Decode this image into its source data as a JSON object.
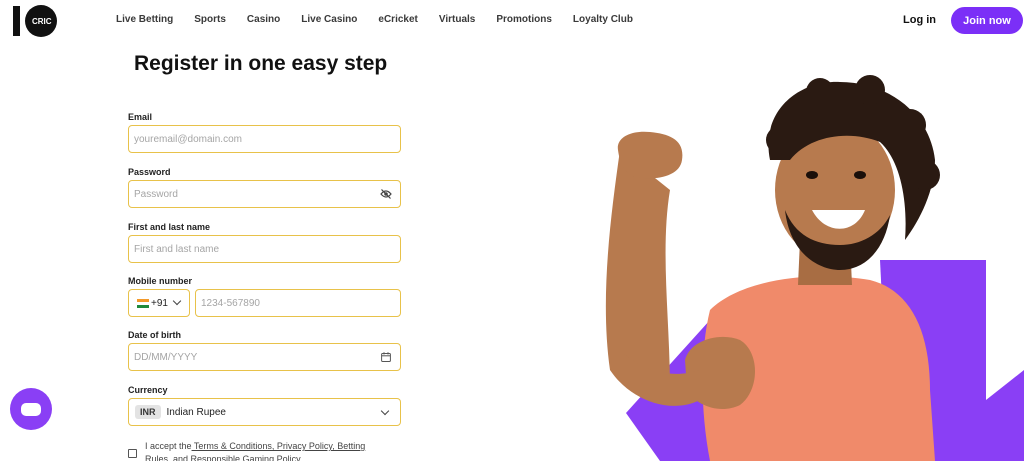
{
  "header": {
    "logo_text": "CRIC",
    "nav": [
      "Live Betting",
      "Sports",
      "Casino",
      "Live Casino",
      "eCricket",
      "Virtuals",
      "Promotions",
      "Loyalty Club"
    ],
    "login_label": "Log in",
    "join_label": "Join now"
  },
  "form": {
    "title": "Register in one easy step",
    "email_label": "Email",
    "email_placeholder": "youremail@domain.com",
    "password_label": "Password",
    "password_placeholder": "Password",
    "name_label": "First and last name",
    "name_placeholder": "First and last name",
    "mobile_label": "Mobile number",
    "country_code": "+91",
    "mobile_placeholder": "1234-567890",
    "dob_label": "Date of birth",
    "dob_placeholder": "DD/MM/YYYY",
    "currency_label": "Currency",
    "currency_code": "INR",
    "currency_name": "Indian Rupee",
    "accept_prefix": "I accept the",
    "accept_links": " Terms & Conditions, Privacy Policy, Betting Rules, and Responsible Gaming Policy"
  },
  "colors": {
    "accent": "#7b2ff7",
    "field_border": "#e8c24a",
    "hero_purple": "#8a3ff5"
  },
  "icons": [
    "eye-off-icon",
    "calendar-icon",
    "chevron-down-icon",
    "india-flag-icon",
    "chat-icon"
  ]
}
